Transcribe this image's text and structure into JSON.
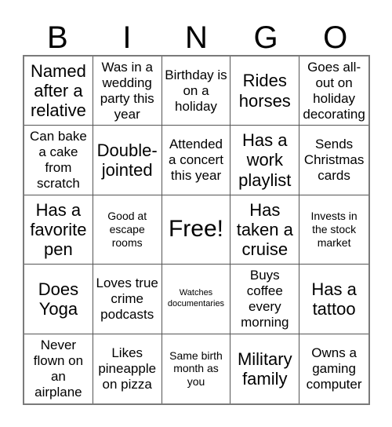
{
  "header": {
    "letters": [
      "B",
      "I",
      "N",
      "G",
      "O"
    ]
  },
  "grid": {
    "rows": 5,
    "columns": 5,
    "cells": [
      {
        "text": "Named after a relative",
        "size": "lg"
      },
      {
        "text": "Was in a wedding party this year",
        "size": "md"
      },
      {
        "text": "Birthday is on a holiday",
        "size": "md"
      },
      {
        "text": "Rides horses",
        "size": "lg"
      },
      {
        "text": "Goes all-out on holiday decorating",
        "size": "md"
      },
      {
        "text": "Can bake a cake from scratch",
        "size": "md"
      },
      {
        "text": "Double-jointed",
        "size": "lg"
      },
      {
        "text": "Attended a concert this year",
        "size": "md"
      },
      {
        "text": "Has a work playlist",
        "size": "lg"
      },
      {
        "text": "Sends Christmas cards",
        "size": "md"
      },
      {
        "text": "Has a favorite pen",
        "size": "lg"
      },
      {
        "text": "Good at escape rooms",
        "size": "sm"
      },
      {
        "text": "Free!",
        "size": "xl"
      },
      {
        "text": "Has taken a cruise",
        "size": "lg"
      },
      {
        "text": "Invests in the stock market",
        "size": "sm"
      },
      {
        "text": "Does Yoga",
        "size": "lg"
      },
      {
        "text": "Loves true crime podcasts",
        "size": "md"
      },
      {
        "text": "Watches documentaries",
        "size": "xs"
      },
      {
        "text": "Buys coffee every morning",
        "size": "md"
      },
      {
        "text": "Has a tattoo",
        "size": "lg"
      },
      {
        "text": "Never flown on an airplane",
        "size": "md"
      },
      {
        "text": "Likes pineapple on pizza",
        "size": "md"
      },
      {
        "text": "Same birth month as you",
        "size": "sm"
      },
      {
        "text": "Military family",
        "size": "lg"
      },
      {
        "text": "Owns a gaming computer",
        "size": "md"
      }
    ]
  },
  "colors": {
    "background": "#ffffff",
    "text": "#000000",
    "grid_line": "#555555",
    "grid_outer": "#7a7a7a"
  }
}
